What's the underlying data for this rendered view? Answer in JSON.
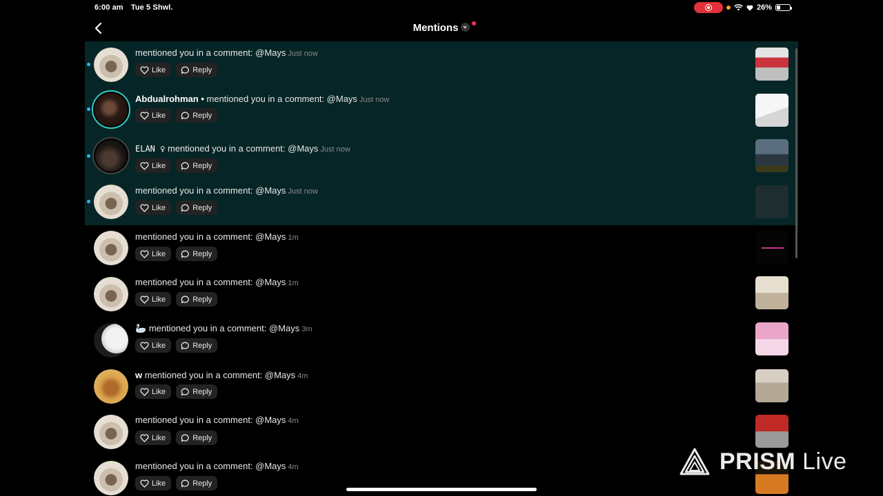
{
  "status_bar": {
    "time": "6:00 am",
    "date": "Tue 5 Shwl.",
    "battery": "26%"
  },
  "header": {
    "title": "Mentions"
  },
  "action_labels": {
    "like": "Like",
    "reply": "Reply"
  },
  "mentions": [
    {
      "username": "",
      "text": "mentioned you in a comment: @Mays",
      "time": "Just now",
      "unread": true
    },
    {
      "username": "Abdualrohman •",
      "text": "mentioned you in a comment: @Mays",
      "time": "Just now",
      "unread": true
    },
    {
      "username": "ELAN ♀",
      "text": "mentioned you in a comment: @Mays",
      "time": "Just now",
      "unread": true
    },
    {
      "username": "",
      "text": "mentioned you in a comment: @Mays",
      "time": "Just now",
      "unread": true
    },
    {
      "username": "",
      "text": "mentioned you in a comment: @Mays",
      "time": "1m",
      "unread": false
    },
    {
      "username": "",
      "text": "mentioned you in a comment: @Mays",
      "time": "1m",
      "unread": false
    },
    {
      "username": "🦢",
      "text": "mentioned you in a comment: @Mays",
      "time": "3m",
      "unread": false
    },
    {
      "username": "w",
      "text": "mentioned you in a comment: @Mays",
      "time": "4m",
      "unread": false
    },
    {
      "username": "",
      "text": "mentioned you in a comment: @Mays",
      "time": "4m",
      "unread": false
    },
    {
      "username": "",
      "text": "mentioned you in a comment: @Mays",
      "time": "4m",
      "unread": false
    }
  ],
  "watermark": {
    "brand": "PRISM",
    "suffix": "Live"
  }
}
